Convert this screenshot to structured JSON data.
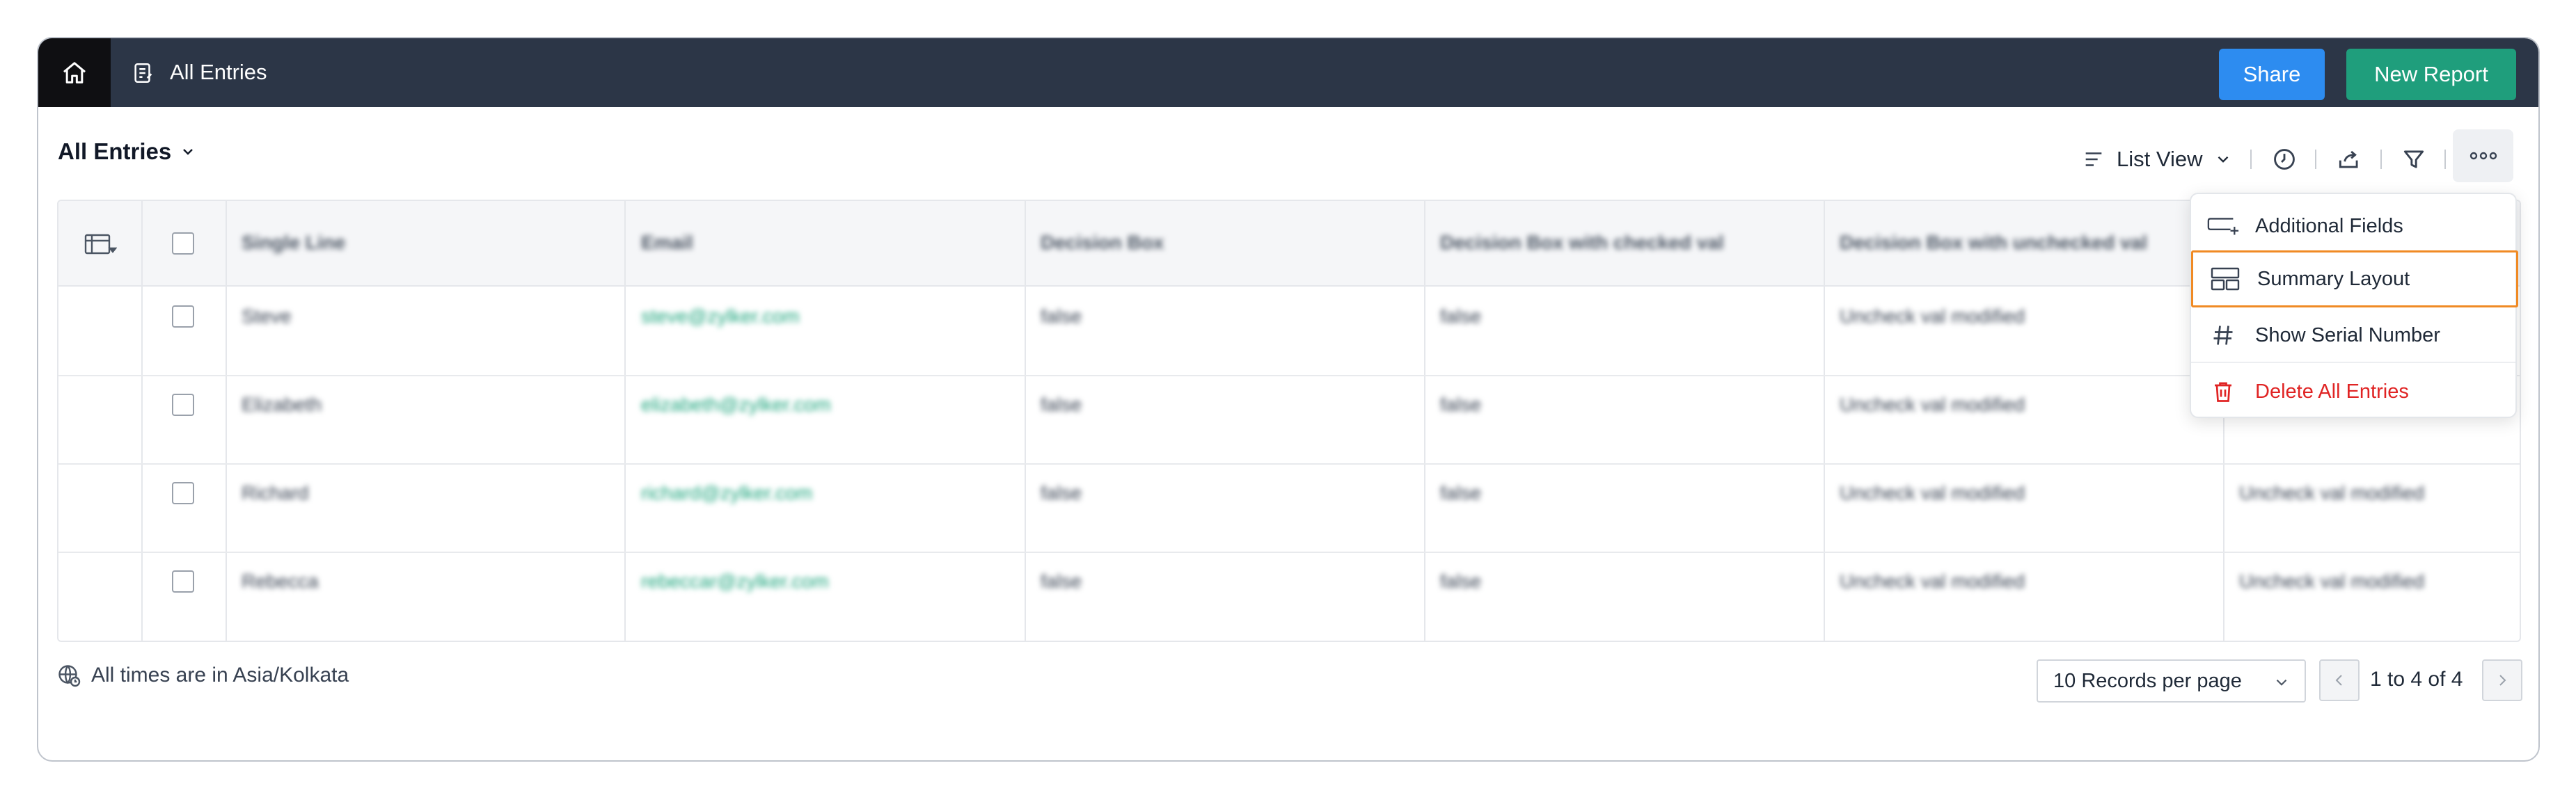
{
  "topbar": {
    "title": "All Entries",
    "share_label": "Share",
    "new_report_label": "New Report"
  },
  "header": {
    "view_title": "All Entries",
    "view_mode": "List View"
  },
  "table": {
    "columns": [
      "Single Line",
      "Email",
      "Decision Box",
      "Decision Box with checked val",
      "Decision Box with unchecked val"
    ],
    "rows": [
      [
        "Steve",
        "steve@zylker.com",
        "false",
        "false",
        "Uncheck val modified",
        ""
      ],
      [
        "Elizabeth",
        "elizabeth@zylker.com",
        "false",
        "false",
        "Uncheck val modified",
        ""
      ],
      [
        "Richard",
        "richard@zylker.com",
        "false",
        "false",
        "Uncheck val modified",
        "Uncheck val modified"
      ],
      [
        "Rebecca",
        "rebeccar@zylker.com",
        "false",
        "false",
        "Uncheck val modified",
        "Uncheck val modified"
      ]
    ]
  },
  "footer": {
    "timezone_text": "All times are in Asia/Kolkata",
    "records_per_page": "10 Records per page",
    "pagination_text": "1 to 4 of 4"
  },
  "menu": {
    "items": [
      {
        "label": "Additional Fields",
        "icon": "additional-fields-icon"
      },
      {
        "label": "Summary Layout",
        "icon": "summary-layout-icon"
      },
      {
        "label": "Show Serial Number",
        "icon": "hash-icon"
      },
      {
        "label": "Delete All Entries",
        "icon": "trash-icon"
      }
    ]
  },
  "colors": {
    "topbar": "#2c3647",
    "share": "#2d8cf0",
    "new_report": "#1f9e7c",
    "active_outline": "#f08a24",
    "danger": "#e02424",
    "email_text": "#19a37a"
  }
}
